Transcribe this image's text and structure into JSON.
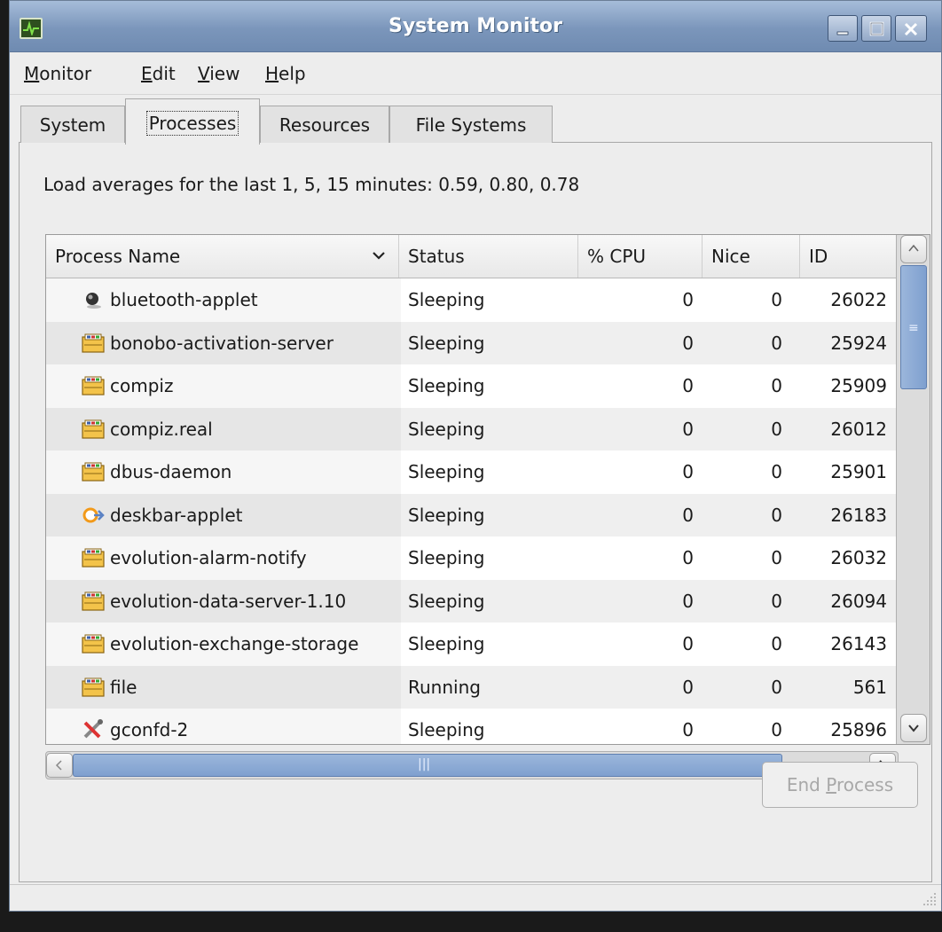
{
  "window": {
    "title": "System Monitor"
  },
  "menu": [
    {
      "pre": "",
      "mn": "M",
      "post": "onitor"
    },
    {
      "pre": "",
      "mn": "E",
      "post": "dit"
    },
    {
      "pre": "",
      "mn": "V",
      "post": "iew"
    },
    {
      "pre": "",
      "mn": "H",
      "post": "elp"
    }
  ],
  "tabs": [
    "System",
    "Processes",
    "Resources",
    "File Systems"
  ],
  "active_tab": "Processes",
  "load_averages": "Load averages for the last 1, 5, 15 minutes: 0.59, 0.80, 0.78",
  "columns": [
    "Process Name",
    "Status",
    "% CPU",
    "Nice",
    "ID"
  ],
  "processes": [
    {
      "icon": "bluetooth-icon",
      "name": "bluetooth-applet",
      "status": "Sleeping",
      "cpu": "0",
      "nice": "0",
      "id": "26022"
    },
    {
      "icon": "executable-icon",
      "name": "bonobo-activation-server",
      "status": "Sleeping",
      "cpu": "0",
      "nice": "0",
      "id": "25924"
    },
    {
      "icon": "executable-icon",
      "name": "compiz",
      "status": "Sleeping",
      "cpu": "0",
      "nice": "0",
      "id": "25909"
    },
    {
      "icon": "executable-icon",
      "name": "compiz.real",
      "status": "Sleeping",
      "cpu": "0",
      "nice": "0",
      "id": "26012"
    },
    {
      "icon": "executable-icon",
      "name": "dbus-daemon",
      "status": "Sleeping",
      "cpu": "0",
      "nice": "0",
      "id": "25901"
    },
    {
      "icon": "deskbar-icon",
      "name": "deskbar-applet",
      "status": "Sleeping",
      "cpu": "0",
      "nice": "0",
      "id": "26183"
    },
    {
      "icon": "executable-icon",
      "name": "evolution-alarm-notify",
      "status": "Sleeping",
      "cpu": "0",
      "nice": "0",
      "id": "26032"
    },
    {
      "icon": "executable-icon",
      "name": "evolution-data-server-1.10",
      "status": "Sleeping",
      "cpu": "0",
      "nice": "0",
      "id": "26094"
    },
    {
      "icon": "executable-icon",
      "name": "evolution-exchange-storage",
      "status": "Sleeping",
      "cpu": "0",
      "nice": "0",
      "id": "26143"
    },
    {
      "icon": "executable-icon",
      "name": "file",
      "status": "Running",
      "cpu": "0",
      "nice": "0",
      "id": "561"
    },
    {
      "icon": "tools-icon",
      "name": "gconfd-2",
      "status": "Sleeping",
      "cpu": "0",
      "nice": "0",
      "id": "25896"
    }
  ],
  "end_process": {
    "pre": "End ",
    "mn": "P",
    "post": "rocess"
  },
  "colors": {
    "titlebar": "#7b96bb",
    "selection": "#8aaad4"
  }
}
